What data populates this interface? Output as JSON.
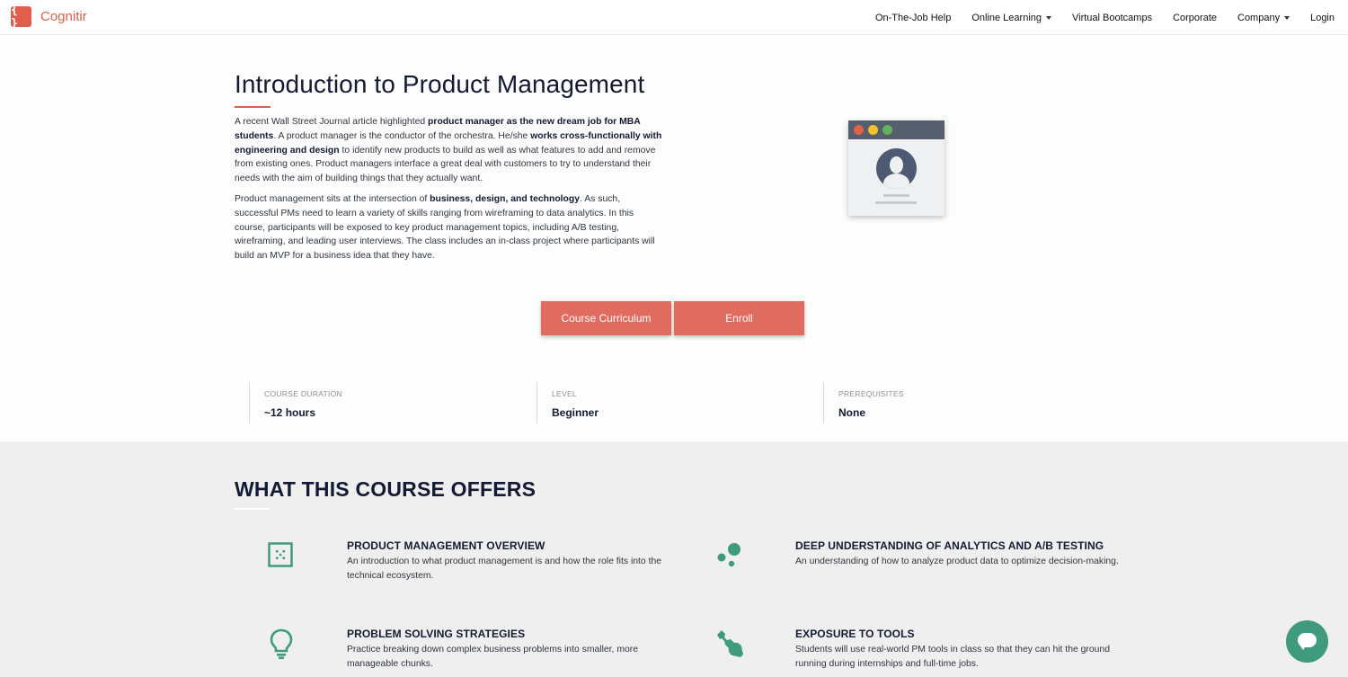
{
  "brand": {
    "name": "Cognitir",
    "logo_glyph": "{ }",
    "accent": "#e05e4b"
  },
  "nav": {
    "items": [
      {
        "label": "On-The-Job Help",
        "dropdown": false
      },
      {
        "label": "Online Learning",
        "dropdown": true
      },
      {
        "label": "Virtual Bootcamps",
        "dropdown": false
      },
      {
        "label": "Corporate",
        "dropdown": false
      },
      {
        "label": "Company",
        "dropdown": true
      },
      {
        "label": "Login",
        "dropdown": false
      }
    ]
  },
  "hero": {
    "title": "Introduction to Product Management",
    "p1": [
      {
        "t": "A recent Wall Street Journal article highlighted ",
        "b": false
      },
      {
        "t": "product manager as the new dream job for MBA students",
        "b": true
      },
      {
        "t": ". A product manager is the conductor of the orchestra. He/she ",
        "b": false
      },
      {
        "t": "works cross-functionally with engineering and design",
        "b": true
      },
      {
        "t": " to identify new products to build as well as what features to add and remove from existing ones. Product managers interface a great deal with customers to try to understand their needs with the aim of building things that they actually want.",
        "b": false
      }
    ],
    "p2": [
      {
        "t": "Product management sits at the intersection of ",
        "b": false
      },
      {
        "t": "business, design, and technology",
        "b": true
      },
      {
        "t": ". As such, successful PMs need to learn a variety of skills ranging from wireframing to data analytics. In this course, participants will be exposed to key product management topics, including A/B testing, wireframing, and leading user interviews. The class includes an in-class project where participants will build an MVP for a business idea that they have.",
        "b": false
      }
    ]
  },
  "buttons": {
    "curriculum": "Course Curriculum",
    "enroll": "Enroll",
    "color": "#e06c5f"
  },
  "stats": [
    {
      "label": "COURSE DURATION",
      "value": "~12 hours"
    },
    {
      "label": "LEVEL",
      "value": "Beginner"
    },
    {
      "label": "PREREQUISITES",
      "value": "None"
    }
  ],
  "offers": {
    "title": "WHAT THIS COURSE OFFERS",
    "icon_color": "#3f9a7e",
    "items": [
      {
        "icon": "grid-square-icon",
        "title": "PRODUCT MANAGEMENT OVERVIEW",
        "desc": "An introduction to what product management is and how the role fits into the technical ecosystem."
      },
      {
        "icon": "bubbles-icon",
        "title": "DEEP UNDERSTANDING OF ANALYTICS AND A/B TESTING",
        "desc": "An understanding of how to analyze product data to optimize decision-making."
      },
      {
        "icon": "lightbulb-icon",
        "title": "PROBLEM SOLVING STRATEGIES",
        "desc": "Practice breaking down complex business problems into smaller, more manageable chunks."
      },
      {
        "icon": "wrench-icon",
        "title": "EXPOSURE TO TOOLS",
        "desc": "Students will use real-world PM tools in class so that they can hit the ground running during internships and full-time jobs."
      }
    ]
  },
  "chat": {
    "icon": "chat-icon"
  }
}
